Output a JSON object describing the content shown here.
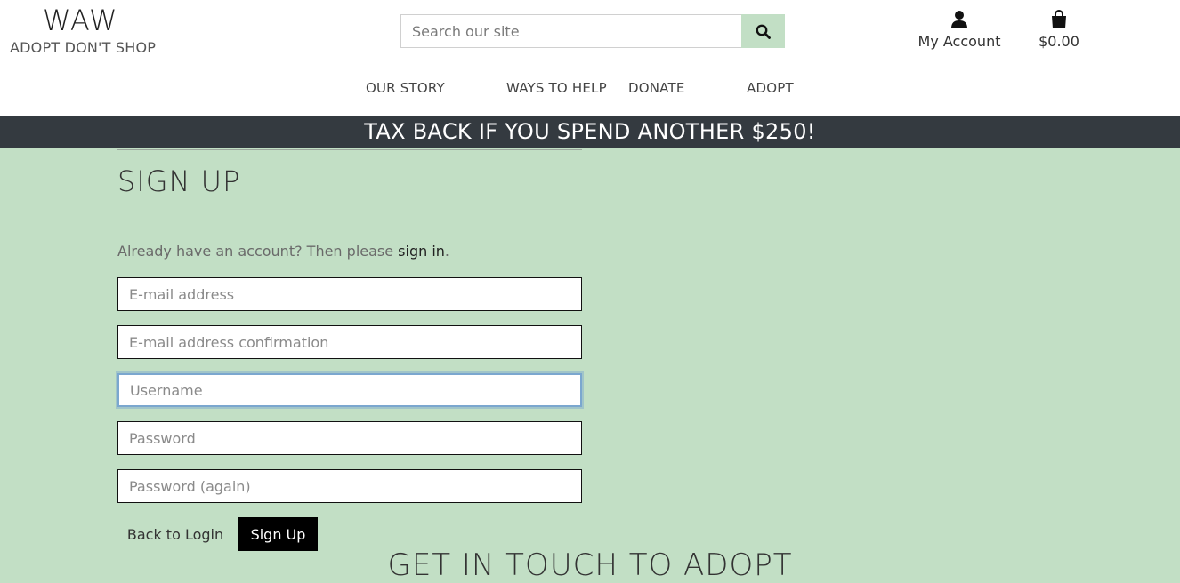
{
  "header": {
    "logo_title": "WAW",
    "logo_tagline": "ADOPT DON'T SHOP",
    "search": {
      "placeholder": "Search our site",
      "value": ""
    },
    "account_label": "My Account",
    "cart_total": "$0.00"
  },
  "nav": {
    "items": [
      {
        "label": "OUR STORY"
      },
      {
        "label": "WAYS TO HELP"
      },
      {
        "label": "DONATE"
      },
      {
        "label": "ADOPT"
      }
    ]
  },
  "banner": {
    "text": "TAX BACK IF YOU SPEND ANOTHER $250!"
  },
  "signup": {
    "title": "SIGN UP",
    "already_text": "Already have an account? Then please ",
    "signin_link": "sign in",
    "already_suffix": ".",
    "fields": {
      "email": "E-mail address",
      "email_confirm": "E-mail address confirmation",
      "username": "Username",
      "password": "Password",
      "password_again": "Password (again)"
    },
    "back_button": "Back to Login",
    "submit_button": "Sign Up"
  },
  "footer": {
    "heading": "GET IN TOUCH TO ADOPT"
  },
  "colors": {
    "accent": "#c2dfc5",
    "banner": "#343a40",
    "button": "#000000"
  }
}
